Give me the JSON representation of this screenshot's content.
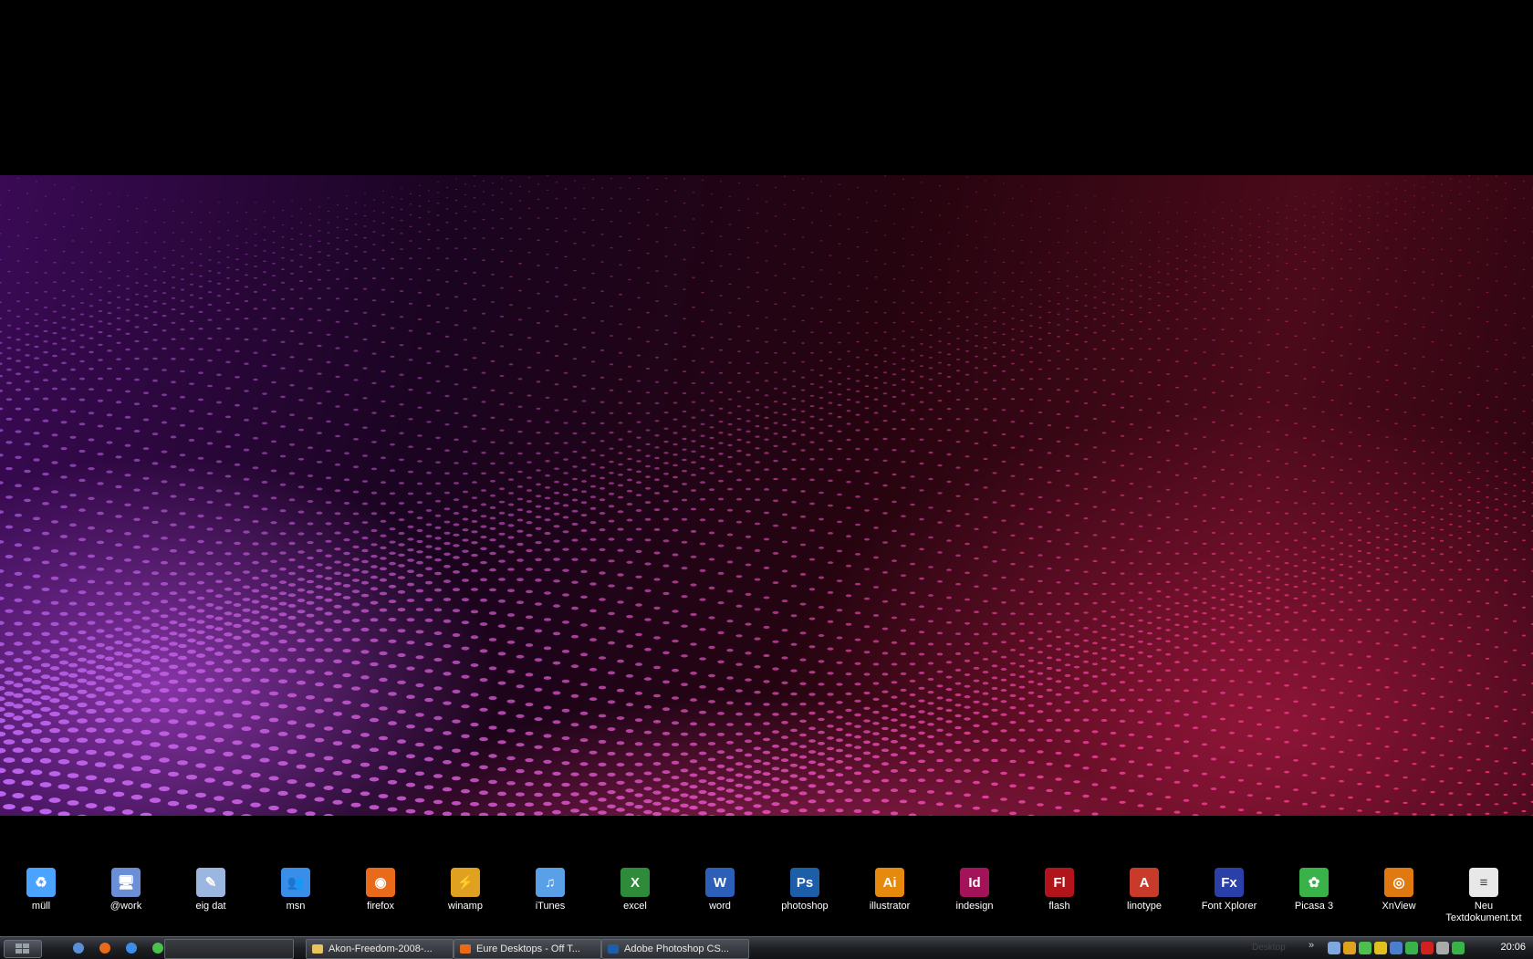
{
  "desktop_icons": [
    {
      "label": "müll",
      "icon": "recycle-bin-icon",
      "color": "#4aa3ff",
      "glyph": "♻"
    },
    {
      "label": "@work",
      "icon": "computer-icon",
      "color": "#6b8fd6",
      "glyph": "🖥"
    },
    {
      "label": "eig dat",
      "icon": "documents-icon",
      "color": "#9bb6e0",
      "glyph": "✎"
    },
    {
      "label": "msn",
      "icon": "msn-messenger-icon",
      "color": "#3b8ee8",
      "glyph": "👥"
    },
    {
      "label": "firefox",
      "icon": "firefox-icon",
      "color": "#e86a1a",
      "glyph": "◉"
    },
    {
      "label": "winamp",
      "icon": "winamp-icon",
      "color": "#e0a020",
      "glyph": "⚡"
    },
    {
      "label": "iTunes",
      "icon": "itunes-icon",
      "color": "#5aa0e8",
      "glyph": "♫"
    },
    {
      "label": "excel",
      "icon": "excel-icon",
      "color": "#2e8b3a",
      "glyph": "X"
    },
    {
      "label": "word",
      "icon": "word-icon",
      "color": "#2b5fb8",
      "glyph": "W"
    },
    {
      "label": "photoshop",
      "icon": "photoshop-icon",
      "color": "#1d5ea8",
      "glyph": "Ps"
    },
    {
      "label": "illustrator",
      "icon": "illustrator-icon",
      "color": "#e58a0c",
      "glyph": "Ai"
    },
    {
      "label": "indesign",
      "icon": "indesign-icon",
      "color": "#a3135a",
      "glyph": "Id"
    },
    {
      "label": "flash",
      "icon": "flash-icon",
      "color": "#b2141c",
      "glyph": "Fl"
    },
    {
      "label": "linotype",
      "icon": "linotype-icon",
      "color": "#c83a2a",
      "glyph": "A"
    },
    {
      "label": "Font Xplorer",
      "icon": "font-xplorer-icon",
      "color": "#2a3fa8",
      "glyph": "Fx"
    },
    {
      "label": "Picasa 3",
      "icon": "picasa-icon",
      "color": "#39b24a",
      "glyph": "✿"
    },
    {
      "label": "XnView",
      "icon": "xnview-icon",
      "color": "#e07a10",
      "glyph": "◎"
    },
    {
      "label": "Neu Textdokument.txt",
      "icon": "text-document-icon",
      "color": "#e8e8e8",
      "glyph": "≡"
    }
  ],
  "taskbar": {
    "quick_launch": [
      {
        "icon": "show-desktop-icon",
        "color": "#5a8fd8"
      },
      {
        "icon": "firefox-icon",
        "color": "#e86a1a"
      },
      {
        "icon": "internet-explorer-icon",
        "color": "#3b8ee8"
      },
      {
        "icon": "msn-messenger-icon",
        "color": "#4cc04c"
      }
    ],
    "tasks": [
      {
        "label": "Akon-Freedom-2008-...",
        "icon": "folder-icon",
        "color": "#e8c45a"
      },
      {
        "label": "Eure Desktops - Off T...",
        "icon": "firefox-icon",
        "color": "#e86a1a"
      },
      {
        "label": "Adobe Photoshop CS...",
        "icon": "photoshop-icon",
        "color": "#1d5ea8"
      }
    ],
    "desktop_toolbar_label": "Desktop",
    "chevron": "»",
    "tray_icons": [
      {
        "icon": "network-icon",
        "color": "#7fa8e0"
      },
      {
        "icon": "winamp-agent-icon",
        "color": "#e0a020"
      },
      {
        "icon": "msn-status-icon",
        "color": "#4cc04c"
      },
      {
        "icon": "nvidia-icon",
        "color": "#e0c020"
      },
      {
        "icon": "3d-icon",
        "color": "#4a7fd0"
      },
      {
        "icon": "safely-remove-icon",
        "color": "#39b24a"
      },
      {
        "icon": "antivirus-icon",
        "color": "#d02020"
      },
      {
        "icon": "sound-icon",
        "color": "#aaaaaa"
      },
      {
        "icon": "update-icon",
        "color": "#39b24a"
      }
    ],
    "clock": "20:06"
  }
}
